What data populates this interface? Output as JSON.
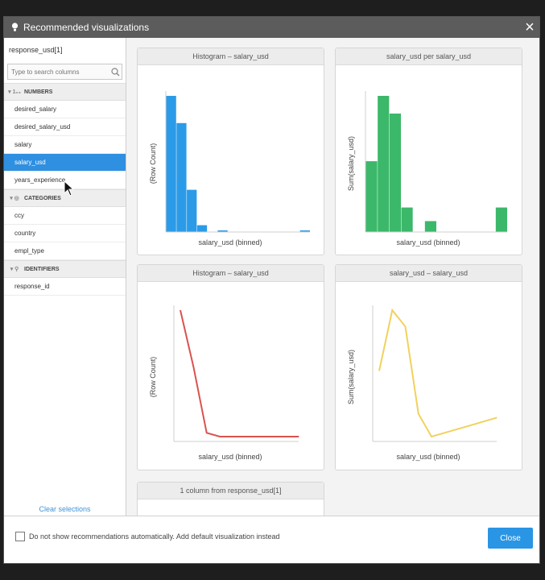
{
  "dialog": {
    "title": "Recommended visualizations"
  },
  "sidebar": {
    "dataset": "response_usd[1]",
    "search_placeholder": "Type to search columns",
    "groups": [
      {
        "label": "NUMBERS",
        "items": [
          "desired_salary",
          "desired_salary_usd",
          "salary",
          "salary_usd",
          "years_experience"
        ]
      },
      {
        "label": "CATEGORIES",
        "items": [
          "ccy",
          "country",
          "empl_type"
        ]
      },
      {
        "label": "IDENTIFIERS",
        "items": [
          "response_id"
        ]
      }
    ],
    "selected": "salary_usd",
    "clear_label": "Clear selections"
  },
  "cards": [
    {
      "title": "Histogram – salary_usd",
      "xlabel": "salary_usd (binned)",
      "ylabel": "(Row Count)"
    },
    {
      "title": "salary_usd per salary_usd",
      "xlabel": "salary_usd (binned)",
      "ylabel": "Sum(salary_usd)"
    },
    {
      "title": "Histogram – salary_usd",
      "xlabel": "salary_usd (binned)",
      "ylabel": "(Row Count)"
    },
    {
      "title": "salary_usd – salary_usd",
      "xlabel": "salary_usd (binned)",
      "ylabel": "Sum(salary_usd)"
    },
    {
      "title": "1 column from response_usd[1]"
    }
  ],
  "chart_data": [
    {
      "type": "bar",
      "color": "#2b9be8",
      "values": [
        100,
        80,
        31,
        5,
        0,
        1,
        0,
        0,
        0,
        0,
        0,
        0,
        0,
        1
      ],
      "xlabel": "salary_usd (binned)",
      "ylabel": "(Row Count)"
    },
    {
      "type": "bar",
      "color": "#3cb86a",
      "values": [
        52,
        100,
        87,
        18,
        0,
        8,
        0,
        0,
        0,
        0,
        0,
        18
      ],
      "xlabel": "salary_usd (binned)",
      "ylabel": "Sum(salary_usd)"
    },
    {
      "type": "line",
      "color": "#d9534f",
      "values": [
        100,
        55,
        3,
        0,
        0,
        0,
        0,
        0,
        0,
        0
      ],
      "xlabel": "salary_usd (binned)",
      "ylabel": "(Row Count)"
    },
    {
      "type": "line",
      "color": "#f2d15c",
      "values": [
        52,
        100,
        87,
        18,
        0,
        3,
        6,
        9,
        12,
        15
      ],
      "xlabel": "salary_usd (binned)",
      "ylabel": "Sum(salary_usd)"
    }
  ],
  "footer": {
    "checkbox_label": "Do not show recommendations automatically. Add default visualization instead",
    "close_label": "Close"
  }
}
